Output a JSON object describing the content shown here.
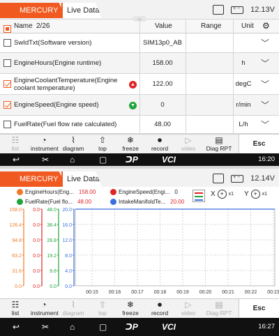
{
  "header": {
    "brand": "MERCURY",
    "tab": "Live Data"
  },
  "screen1": {
    "voltage": "12.13V",
    "columns": {
      "name": "Name",
      "count": "2/26",
      "value": "Value",
      "range": "Range",
      "unit": "Unit"
    },
    "rows": [
      {
        "name": "SwIdTxt(Software version)",
        "value": "SIM13p0_AB",
        "unit": "",
        "checked": false
      },
      {
        "name": "EngineHours(Engine runtime)",
        "value": "158.00",
        "unit": "h",
        "checked": false
      },
      {
        "name": "EngineCoolantTemperature(Engine coolant temperature)",
        "value": "122.00",
        "unit": "degC",
        "checked": true,
        "indicator": "up"
      },
      {
        "name": "EngineSpeed(Engine speed)",
        "value": "0",
        "unit": "r/min",
        "checked": true,
        "indicator": "down"
      },
      {
        "name": "FuelRate(Fuel flow rate calculated)",
        "value": "48.00",
        "unit": "L/h",
        "checked": false
      }
    ],
    "toolbar": {
      "list": "list",
      "instrument": "instrument",
      "diagram": "diagram",
      "top": "top",
      "freeze": "freeze",
      "record": "record",
      "video": "video",
      "diag_rpt": "Diag RPT",
      "esc": "Esc"
    },
    "time": "16:20"
  },
  "screen2": {
    "voltage": "12.14V",
    "legend": [
      {
        "label": "EngineHours(Eng...",
        "value": "158.00",
        "color": "#f07a2a"
      },
      {
        "label": "EngineSpeed(Engi...",
        "value": "0",
        "color": "#e02424"
      },
      {
        "label": "FuelRate(Fuel flo...",
        "value": "48.00",
        "color": "#1fa33a"
      },
      {
        "label": "IntakeManifoldTe...",
        "value": "20.00",
        "color": "#3a6fe0"
      }
    ],
    "zoom_x": "X",
    "zoom_y": "Y",
    "zoom_level": "x1",
    "toolbar": {
      "list": "list",
      "instrument": "instrument",
      "diagram": "diagram",
      "top": "top",
      "freeze": "freeze",
      "record": "record",
      "video": "video",
      "diag_rpt": "Diag RPT",
      "esc": "Esc"
    },
    "time": "16:27"
  },
  "chart_data": {
    "type": "line",
    "x": [
      "00:15",
      "00:16",
      "00:17",
      "00:18",
      "00:19",
      "00:20",
      "00:21",
      "00:22",
      "00:23"
    ],
    "y_axes": [
      {
        "name": "EngineHours",
        "color": "#f07a2a",
        "ticks": [
          "158.0",
          "126.4",
          "94.8",
          "63.2",
          "31.6",
          "0.0"
        ],
        "ylim": [
          0,
          158
        ]
      },
      {
        "name": "EngineSpeed",
        "color": "#e02424",
        "ticks": [
          "0.0",
          "0.0",
          "0.0",
          "0.0",
          "0.0",
          "0.0"
        ],
        "ylim": [
          0,
          0
        ]
      },
      {
        "name": "FuelRate",
        "color": "#1fa33a",
        "ticks": [
          "48.0",
          "38.4",
          "28.8",
          "19.2",
          "9.6",
          "0.0"
        ],
        "ylim": [
          0,
          48
        ]
      },
      {
        "name": "IntakeManifoldTemp",
        "color": "#3a6fe0",
        "ticks": [
          "20.0",
          "16.0",
          "12.0",
          "8.0",
          "4.0",
          "0.0"
        ],
        "ylim": [
          0,
          20
        ]
      }
    ],
    "series": [
      {
        "name": "IntakeManifoldTe...",
        "values": [
          20,
          20,
          20,
          20,
          20,
          20,
          20,
          20,
          20
        ],
        "axis": 3
      }
    ],
    "grid": true
  },
  "colors": {
    "accent": "#f05a20",
    "navbar": "#111111"
  }
}
